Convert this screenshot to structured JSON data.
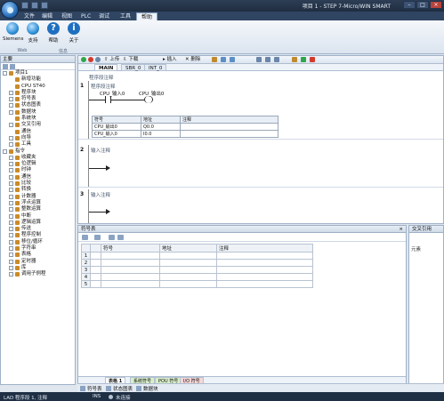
{
  "window": {
    "title": "项目 1 - STEP 7-Micro/WIN SMART"
  },
  "menu": [
    "文件",
    "编辑",
    "视图",
    "PLC",
    "调试",
    "工具",
    "帮助"
  ],
  "menu_active": "帮助",
  "ribbon": {
    "buttons": [
      {
        "label": "Siemens",
        "icon": "siemens-globe-icon",
        "color": "#2e8fd6"
      },
      {
        "label": "支持",
        "icon": "support-globe-icon",
        "color": "#2e8fd6"
      },
      {
        "label": "帮助",
        "icon": "help-icon",
        "color": "#1f6fc0"
      },
      {
        "label": "关于",
        "icon": "info-icon",
        "color": "#1f6fc0"
      }
    ],
    "groups": [
      "Web",
      "信息"
    ]
  },
  "project_tree": {
    "title": "主要",
    "items": [
      {
        "label": "项目1",
        "indent": 0,
        "expand": "-"
      },
      {
        "label": "新增功能",
        "indent": 1,
        "expand": ""
      },
      {
        "label": "CPU ST40",
        "indent": 1,
        "expand": ""
      },
      {
        "label": "程序块",
        "indent": 1,
        "expand": "+"
      },
      {
        "label": "符号表",
        "indent": 1,
        "expand": "+"
      },
      {
        "label": "状态图表",
        "indent": 1,
        "expand": "+"
      },
      {
        "label": "数据块",
        "indent": 1,
        "expand": "+"
      },
      {
        "label": "系统块",
        "indent": 1,
        "expand": ""
      },
      {
        "label": "交叉引用",
        "indent": 1,
        "expand": "+"
      },
      {
        "label": "通信",
        "indent": 1,
        "expand": ""
      },
      {
        "label": "向导",
        "indent": 1,
        "expand": "+"
      },
      {
        "label": "工具",
        "indent": 1,
        "expand": "+"
      },
      {
        "label": "指令",
        "indent": 0,
        "expand": "-"
      },
      {
        "label": "收藏夹",
        "indent": 1,
        "expand": "+"
      },
      {
        "label": "位逻辑",
        "indent": 1,
        "expand": "+"
      },
      {
        "label": "时钟",
        "indent": 1,
        "expand": "+"
      },
      {
        "label": "通信",
        "indent": 1,
        "expand": "+"
      },
      {
        "label": "比较",
        "indent": 1,
        "expand": "+"
      },
      {
        "label": "转换",
        "indent": 1,
        "expand": "+"
      },
      {
        "label": "计数器",
        "indent": 1,
        "expand": "+"
      },
      {
        "label": "浮点运算",
        "indent": 1,
        "expand": "+"
      },
      {
        "label": "整数运算",
        "indent": 1,
        "expand": "+"
      },
      {
        "label": "中断",
        "indent": 1,
        "expand": "+"
      },
      {
        "label": "逻辑运算",
        "indent": 1,
        "expand": "+"
      },
      {
        "label": "传送",
        "indent": 1,
        "expand": "+"
      },
      {
        "label": "程序控制",
        "indent": 1,
        "expand": "+"
      },
      {
        "label": "移位/循环",
        "indent": 1,
        "expand": "+"
      },
      {
        "label": "字符串",
        "indent": 1,
        "expand": "+"
      },
      {
        "label": "表格",
        "indent": 1,
        "expand": "+"
      },
      {
        "label": "定时器",
        "indent": 1,
        "expand": "+"
      },
      {
        "label": "库",
        "indent": 1,
        "expand": "+"
      },
      {
        "label": "调用子例程",
        "indent": 1,
        "expand": "+"
      }
    ]
  },
  "editor": {
    "toolbar": {
      "upload": "上传",
      "download": "下载",
      "insert": "插入",
      "delete": "删除"
    },
    "tabs": [
      "MAIN",
      "SBR_0",
      "INT_0"
    ],
    "active_tab": "MAIN",
    "program_comment": "程序段注释",
    "networks": [
      {
        "number": "1",
        "comment": "程序段注释",
        "contact": "CPU_输入0",
        "coil": "CPU_输出0",
        "symbol_table": {
          "headers": [
            "符号",
            "地址",
            "注释"
          ],
          "rows": [
            [
              "CPU_输出0",
              "Q0.0",
              ""
            ],
            [
              "CPU_输入0",
              "I0.0",
              ""
            ]
          ]
        }
      },
      {
        "number": "2",
        "comment": "输入注释"
      },
      {
        "number": "3",
        "comment": "输入注释"
      }
    ]
  },
  "symbol_panel": {
    "title": "符号表",
    "close": "×",
    "headers": [
      "",
      "",
      "符号",
      "地址",
      "注释"
    ],
    "rows": [
      "1",
      "2",
      "3",
      "4",
      "5"
    ],
    "tabs": [
      "表格 1",
      "系统符号",
      "POU 符号",
      "I/O 符号"
    ]
  },
  "cross_ref": {
    "title": "交叉引用",
    "header": "元素"
  },
  "bottom_strip": [
    "符号表",
    "状态图表",
    "数据块"
  ],
  "status": {
    "location": "LAD 程序段 1, 注释",
    "mode": "INS",
    "connection": "未连接"
  }
}
